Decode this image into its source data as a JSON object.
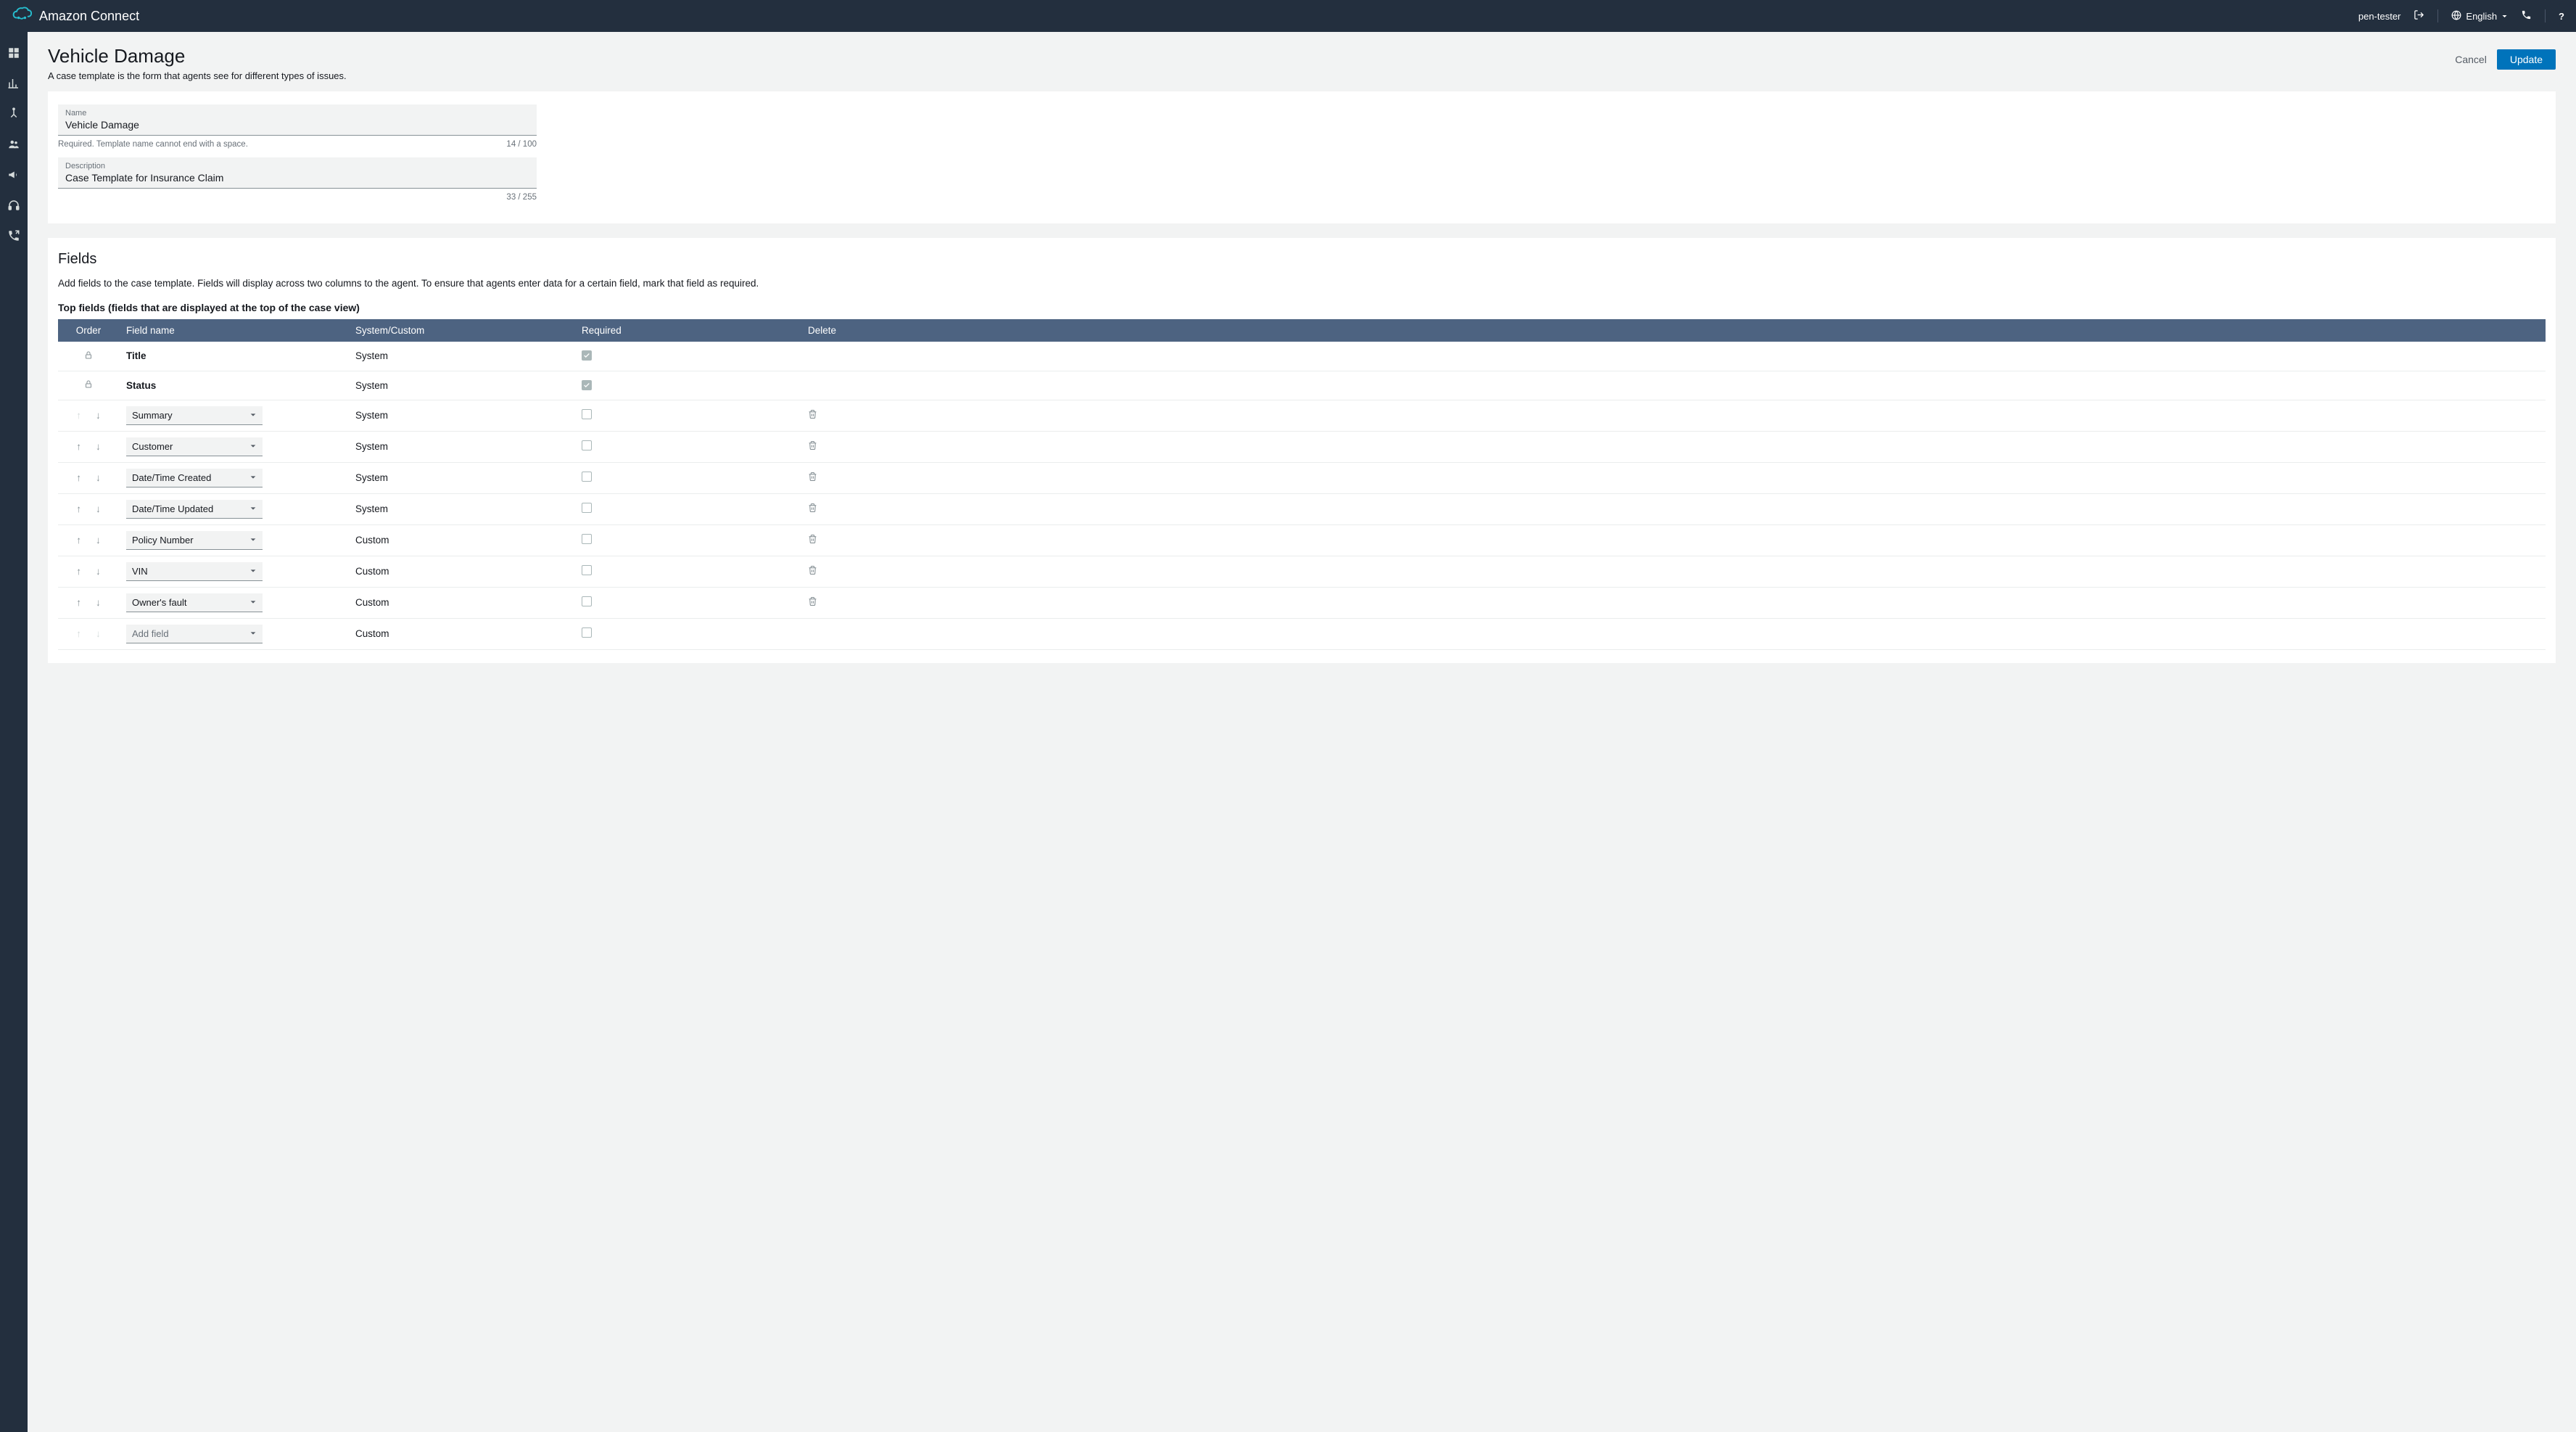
{
  "topnav": {
    "product": "Amazon Connect",
    "user": "pen-tester",
    "language": "English"
  },
  "page": {
    "title": "Vehicle Damage",
    "subtitle": "A case template is the form that agents see for different types of issues.",
    "cancel_label": "Cancel",
    "update_label": "Update"
  },
  "form": {
    "name_label": "Name",
    "name_value": "Vehicle Damage",
    "name_helper": "Required. Template name cannot end with a space.",
    "name_counter": "14 / 100",
    "desc_label": "Description",
    "desc_value": "Case Template for Insurance Claim",
    "desc_counter": "33 / 255"
  },
  "fields_section": {
    "heading": "Fields",
    "note": "Add fields to the case template. Fields will display across two columns to the agent. To ensure that agents enter data for a certain field, mark that field as required.",
    "top_heading": "Top fields (fields that are displayed at the top of the case view)",
    "columns": {
      "order": "Order",
      "name": "Field name",
      "type": "System/Custom",
      "required": "Required",
      "delete": "Delete"
    },
    "rows": [
      {
        "locked": true,
        "name": "Title",
        "dropdown": false,
        "type": "System",
        "required": true,
        "required_disabled": true,
        "deletable": false,
        "up_disabled": true,
        "down_disabled": true
      },
      {
        "locked": true,
        "name": "Status",
        "dropdown": false,
        "type": "System",
        "required": true,
        "required_disabled": true,
        "deletable": false,
        "up_disabled": true,
        "down_disabled": true
      },
      {
        "locked": false,
        "name": "Summary",
        "dropdown": true,
        "type": "System",
        "required": false,
        "required_disabled": false,
        "deletable": true,
        "up_disabled": true,
        "down_disabled": false
      },
      {
        "locked": false,
        "name": "Customer",
        "dropdown": true,
        "type": "System",
        "required": false,
        "required_disabled": false,
        "deletable": true,
        "up_disabled": false,
        "down_disabled": false
      },
      {
        "locked": false,
        "name": "Date/Time Created",
        "dropdown": true,
        "type": "System",
        "required": false,
        "required_disabled": false,
        "deletable": true,
        "up_disabled": false,
        "down_disabled": false
      },
      {
        "locked": false,
        "name": "Date/Time Updated",
        "dropdown": true,
        "type": "System",
        "required": false,
        "required_disabled": false,
        "deletable": true,
        "up_disabled": false,
        "down_disabled": false
      },
      {
        "locked": false,
        "name": "Policy Number",
        "dropdown": true,
        "type": "Custom",
        "required": false,
        "required_disabled": false,
        "deletable": true,
        "up_disabled": false,
        "down_disabled": false
      },
      {
        "locked": false,
        "name": "VIN",
        "dropdown": true,
        "type": "Custom",
        "required": false,
        "required_disabled": false,
        "deletable": true,
        "up_disabled": false,
        "down_disabled": false
      },
      {
        "locked": false,
        "name": "Owner's fault",
        "dropdown": true,
        "type": "Custom",
        "required": false,
        "required_disabled": false,
        "deletable": true,
        "up_disabled": false,
        "down_disabled": false
      },
      {
        "locked": false,
        "name": "Add field",
        "dropdown": true,
        "placeholder": true,
        "type": "Custom",
        "required": false,
        "required_disabled": false,
        "deletable": false,
        "up_disabled": true,
        "down_disabled": true
      }
    ]
  }
}
